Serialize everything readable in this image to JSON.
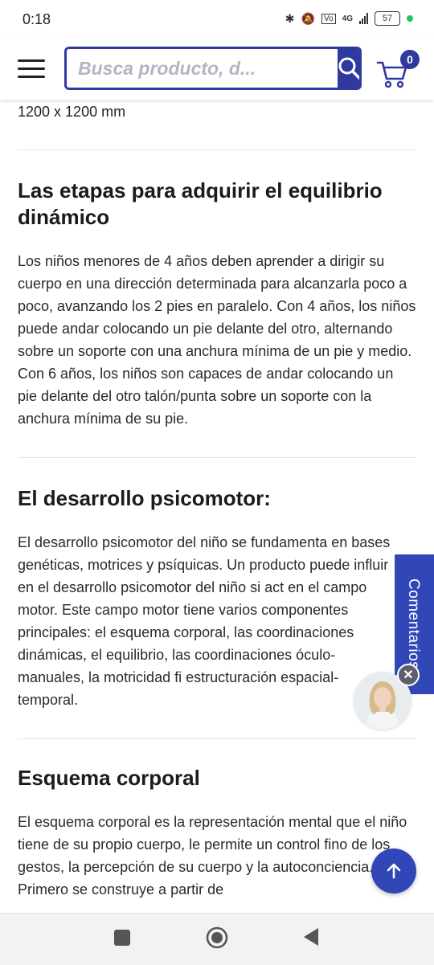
{
  "status": {
    "time": "0:18",
    "network": "4G",
    "battery": "57"
  },
  "header": {
    "search_placeholder": "Busca producto, d...",
    "cart_count": "0"
  },
  "content": {
    "dimension": "1200 x 1200 mm",
    "sections": [
      {
        "title": "Las etapas para adquirir el equilibrio dinámico",
        "paragraph": "Los niños menores de 4 años deben aprender a dirigir su cuerpo en una dirección determinada para alcanzarla poco a poco, avanzando los 2 pies en paralelo. Con 4 años, los niños puede andar colocando un pie delante del otro, alternando sobre un soporte con una anchura mínima de un pie y medio.",
        "paragraph2": "Con 6 años, los niños son capaces de andar colocando un pie delante del otro talón/punta sobre un soporte con la anchura mínima de su pie."
      },
      {
        "title": "El desarrollo psicomotor:",
        "paragraph": "El desarrollo psicomotor del niño se fundamenta en bases genéticas, motrices y psíquicas. Un producto puede influir en el desarrollo psicomotor del niño si act en el campo motor. Este campo motor tiene varios componentes principales: el esquema corporal, las coordinaciones dinámicas, el equilibrio, las coordinaciones óculo-manuales, la motricidad fi estructuración espacial-temporal."
      },
      {
        "title": "Esquema corporal",
        "paragraph": "El esquema corporal es la representación mental que el niño tiene de su propio cuerpo, le permite un control fino de los gestos, la percepción de su cuerpo y la autoconciencia. Primero se construye a partir de"
      }
    ]
  },
  "side_tab": {
    "label": "Comentarios"
  },
  "avatar": {
    "close_label": "✕"
  },
  "colors": {
    "brand": "#2f3a9e",
    "accent": "#3147b8"
  },
  "icons": [
    "menu-icon",
    "search-icon",
    "cart-icon",
    "close-icon",
    "arrow-up-icon",
    "recent-apps-icon",
    "home-icon",
    "back-icon"
  ]
}
